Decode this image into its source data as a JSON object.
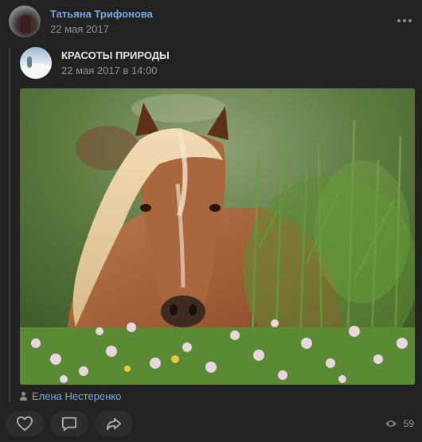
{
  "post": {
    "author": {
      "name": "Татьяна Трифонова",
      "date": "22 мая 2017"
    },
    "repost": {
      "group_name": "КРАСОТЫ ПРИРОДЫ",
      "date": "22 мая 2017 в 14:00"
    },
    "photo": {
      "subject": "horse-in-meadow-photo"
    },
    "source": {
      "author_name": "Елена Нестеренко"
    },
    "actions": {
      "views_count": "59"
    }
  },
  "colors": {
    "background": "#222222",
    "link": "#71aaeb",
    "text_primary": "#e1e3e6",
    "text_secondary": "#939393",
    "button_bg": "#2c2d2e"
  }
}
